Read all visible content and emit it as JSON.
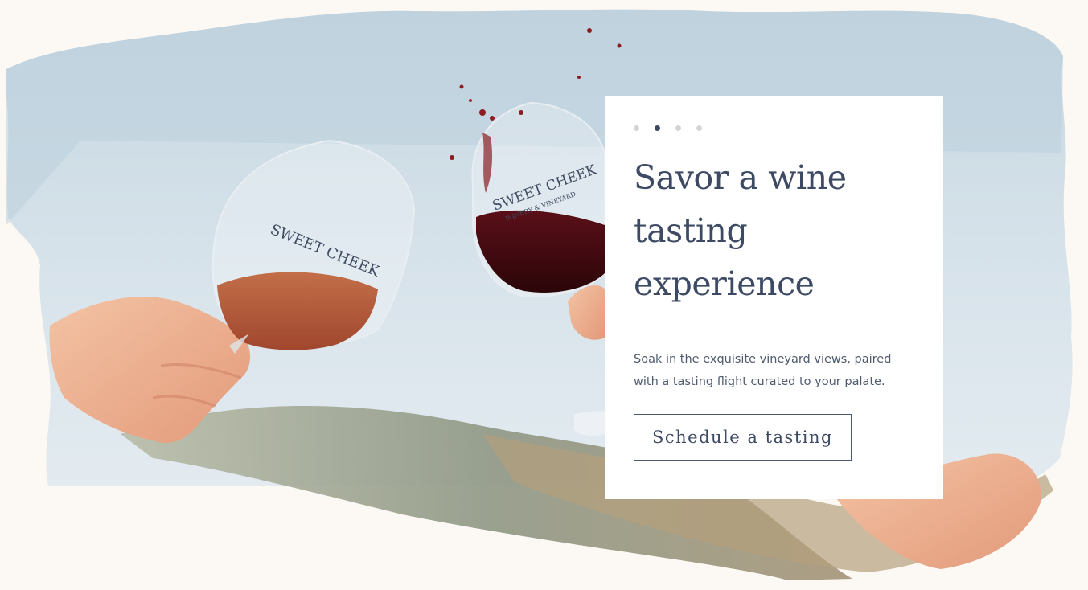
{
  "carousel": {
    "slide_count": 4,
    "active_index": 1
  },
  "hero": {
    "glass_left_text": "SWEET CHEEK",
    "glass_right_text": "SWEET CHEEK",
    "glass_right_subtext": "WINERY & VINEYARD"
  },
  "card": {
    "headline_lines": [
      "Savor a wine",
      "tasting",
      "experience"
    ],
    "description": "Soak in the exquisite vineyard views, paired with a tasting flight curated to your palate.",
    "cta_label": "Schedule a tasting"
  },
  "colors": {
    "background": "#fcf9f5",
    "headline": "#3d4a63",
    "accent_divider": "#e6b3a7",
    "dot_active": "#3c4a61",
    "dot_inactive": "#d4d4d4"
  }
}
